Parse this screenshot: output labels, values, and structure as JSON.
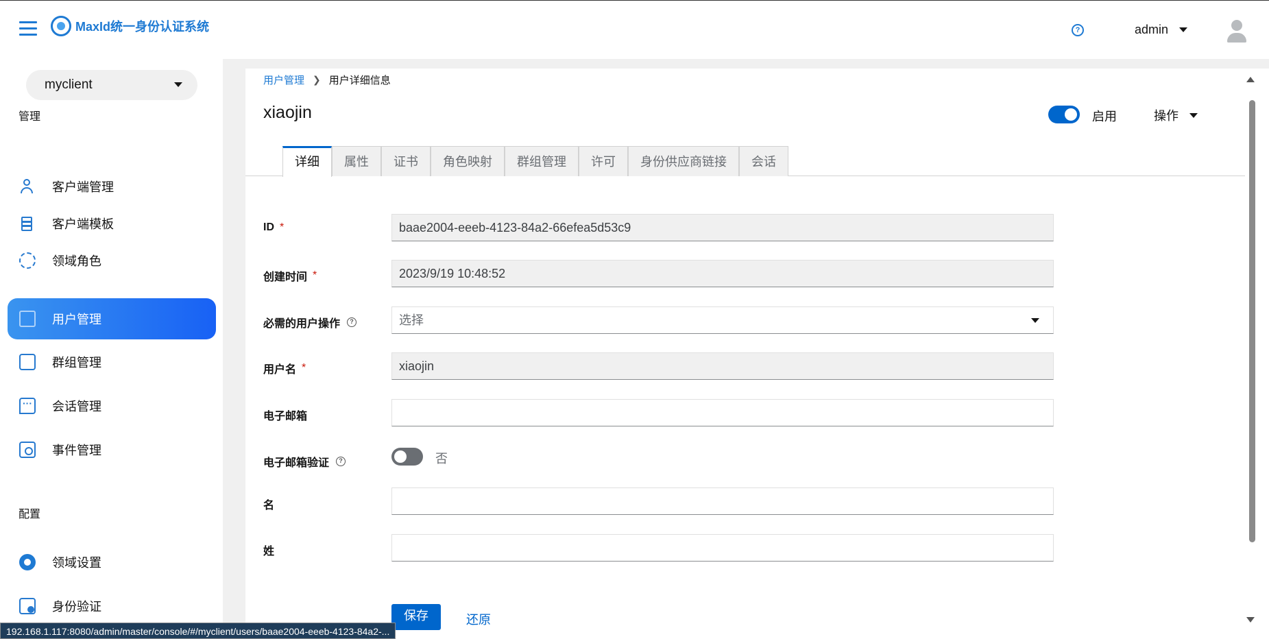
{
  "header": {
    "brand": "MaxId统一身份认证系统",
    "user_name": "admin"
  },
  "sidebar": {
    "realm": "myclient",
    "section_manage": "管理",
    "section_config": "配置",
    "items": [
      {
        "label": "客户端管理",
        "icon": "user-icon"
      },
      {
        "label": "客户端模板",
        "icon": "layers-icon"
      },
      {
        "label": "领域角色",
        "icon": "gear-icon"
      },
      {
        "label": "用户管理",
        "icon": "users-icon",
        "active": true
      },
      {
        "label": "群组管理",
        "icon": "group-icon"
      },
      {
        "label": "会话管理",
        "icon": "chat-icon"
      },
      {
        "label": "事件管理",
        "icon": "event-icon"
      }
    ],
    "config_items": [
      {
        "label": "领域设置",
        "icon": "gear-solid-icon"
      },
      {
        "label": "身份验证",
        "icon": "id-card-icon"
      }
    ]
  },
  "breadcrumb": {
    "parent": "用户管理",
    "current": "用户详细信息"
  },
  "page": {
    "title": "xiaojin",
    "enabled_label": "启用",
    "actions_label": "操作"
  },
  "tabs": [
    "详细",
    "属性",
    "证书",
    "角色映射",
    "群组管理",
    "许可",
    "身份供应商链接",
    "会话"
  ],
  "form": {
    "id_label": "ID",
    "id_value": "baae2004-eeeb-4123-84a2-66efea5d53c9",
    "created_label": "创建时间",
    "created_value": "2023/9/19 10:48:52",
    "required_actions_label": "必需的用户操作",
    "required_actions_placeholder": "选择",
    "username_label": "用户名",
    "username_value": "xiaojin",
    "email_label": "电子邮箱",
    "email_value": "",
    "email_verified_label": "电子邮箱验证",
    "email_verified_state": "否",
    "first_name_label": "名",
    "first_name_value": "",
    "last_name_label": "姓",
    "last_name_value": "",
    "required_mark": "*"
  },
  "buttons": {
    "save": "保存",
    "revert": "还原"
  },
  "status_bar": {
    "url": "192.168.1.117:8080/admin/master/console/#/myclient/users/baae2004-eeeb-4123-84a2-..."
  },
  "colors": {
    "accent": "#0066cc",
    "brand": "#1e7ad3",
    "active_nav_start": "#3a94ef",
    "active_nav_end": "#1861f5"
  }
}
